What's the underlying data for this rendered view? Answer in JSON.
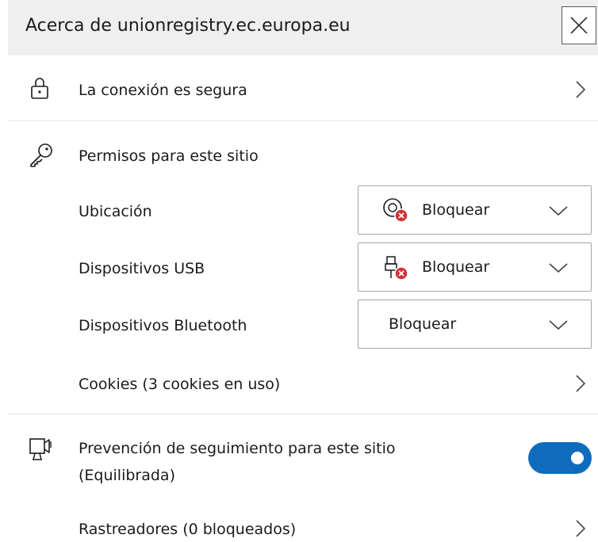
{
  "header": {
    "title": "Acerca de unionregistry.ec.europa.eu"
  },
  "connection": {
    "label": "La conexión es segura",
    "icon": "lock-icon"
  },
  "permissions": {
    "title": "Permisos para este sitio",
    "icon": "key-icon",
    "items": [
      {
        "label": "Ubicación",
        "value": "Bloquear",
        "icon": "location-blocked-icon"
      },
      {
        "label": "Dispositivos USB",
        "value": "Bloquear",
        "icon": "usb-blocked-icon"
      },
      {
        "label": "Dispositivos Bluetooth",
        "value": "Bloquear",
        "icon": ""
      }
    ],
    "cookies_label": "Cookies (3 cookies en uso)"
  },
  "tracking": {
    "title_line1": "Prevención de seguimiento para este sitio",
    "title_line2": "(Equilibrada)",
    "icon": "tracking-prevention-icon",
    "enabled": true,
    "trackers_label": "Rastreadores (0 bloqueados)"
  },
  "colors": {
    "accent": "#0f6cbd",
    "blocked_badge": "#d13438",
    "header_bg": "#efefef"
  }
}
